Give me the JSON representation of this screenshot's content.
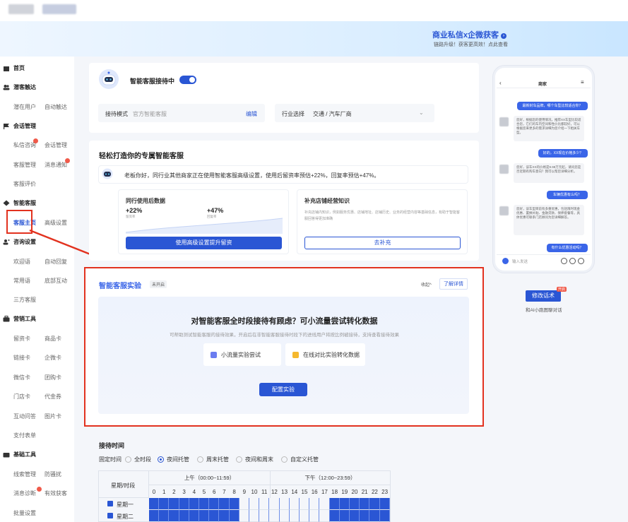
{
  "banner": {
    "title": "商业私信x企微获客",
    "subtitle": "链路升级！获客更高效！点此查看"
  },
  "sidebar": {
    "home": "首页",
    "g_reach": "潜客触达",
    "potential_user": "潜在用户",
    "auto_reach": "自动触达",
    "g_session": "会话管理",
    "private_consult": "私信咨询",
    "session_mgmt": "会话管理",
    "cs_mgmt": "客服管理",
    "msg_notice": "消息通知",
    "cs_review": "客服评价",
    "g_smart": "智能客服",
    "cs_home": "客服主页",
    "advanced": "高级设置",
    "g_consult": "咨询设置",
    "welcome": "欢迎语",
    "auto_reply": "自动回复",
    "common": "常用语",
    "bottom_interact": "底部互动",
    "third_party": "三方客服",
    "g_marketing": "营销工具",
    "reserve_card": "留资卡",
    "goods_card": "商品卡",
    "link_card": "链接卡",
    "wecom_card": "企微卡",
    "wechat_card": "微信卡",
    "group_card": "团购卡",
    "store_card": "门店卡",
    "voucher": "代金券",
    "qa": "互动问答",
    "image_card": "图片卡",
    "pay_form": "支付表单",
    "g_base": "基础工具",
    "clue_mgmt": "线索管理",
    "anti_harass": "防骚扰",
    "msg_diag": "消息诊断",
    "effective_lead": "有效获客",
    "batch_settings": "批量设置"
  },
  "header_card": {
    "bot_title": "智能客服接待中",
    "mode_label": "接待模式",
    "mode_value": "官方智能客服",
    "edit": "编辑",
    "industry_label": "行业选择",
    "industry_value": "交通 / 汽车厂商"
  },
  "promo": {
    "title": "轻松打造你的专属智能客服",
    "message": "老板你好，同行业其他商家正在使用智能客服高级设置，使用后留资率预估+22%，回复率预估+47%。",
    "peer_title": "同行使用后数据",
    "stat1_value": "+22%",
    "stat1_label": "留资率",
    "stat2_value": "+47%",
    "stat2_label": "回复率",
    "peer_btn": "使用高级设置提升留资",
    "kb_title": "补充店铺经营知识",
    "kb_desc": "补充店铺内知识，例如服务优惠、店铺地址、店铺历史、业务的经营内容等基础信息，有助于智能客服回答得更加准确",
    "kb_btn": "去补充"
  },
  "experiment": {
    "title": "智能客服实验",
    "status": "未开启",
    "collapse": "收起^",
    "learn_more": "了解详情",
    "heading": "对智能客服全时段接待有顾虑？可小流量尝试转化数据",
    "desc": "可帮助测试智能客服的接待效果，开启后在非智能客服接待时段下的进线用户将按比例被接待，支持查看接待效果",
    "opt1": "小流量实验尝试",
    "opt2": "在线对比实验转化数据",
    "config_btn": "配置实验"
  },
  "reception": {
    "title": "接待时间",
    "fixed_label": "固定时间",
    "radios": [
      "全时段",
      "夜间托管",
      "周末托管",
      "夜间和周末",
      "自定义托管"
    ],
    "selected_index": 1,
    "col_header": "星期/时段",
    "am": "上午（00:00~11:59）",
    "pm": "下午（12:00~23:59）",
    "hours": [
      "0",
      "1",
      "2",
      "3",
      "4",
      "5",
      "6",
      "7",
      "8",
      "9",
      "10",
      "11",
      "12",
      "13",
      "14",
      "15",
      "16",
      "17",
      "18",
      "19",
      "20",
      "21",
      "22",
      "23"
    ],
    "days": [
      "星期一",
      "星期二"
    ],
    "active_hours": [
      0,
      1,
      2,
      3,
      4,
      5,
      6,
      7,
      8,
      18,
      19,
      20,
      21,
      22,
      23
    ]
  },
  "phone": {
    "title": "商家",
    "q1": "最新封车品牌，哪个车型比较适合你？",
    "a1": "您好，根据您的使用情况，推荐XX车型比较适合您，它们的车内空间和性价比都较好，可以根据您来更多的需求详细为您介绍一下相关车型。",
    "q2": "好的，XX现在价格多少？",
    "a2": "您好，该车XX的价格是9.98万元起，请问您是否近期有购车意向？我可以帮您详细分析。",
    "q3": "车辆优惠有么吗？",
    "a3": "您好，该车型目前有多重优惠，包括限时现金优惠、置换补贴、金融贷款、保养套餐等，具体优惠可联系门店顾问为您详细解答。",
    "q4": "有什么优惠活动吗？",
    "input_placeholder": "输入发送",
    "modify_btn": "修改话术",
    "modify_badge": "开启",
    "caption": "和AI小跑图聊对话"
  },
  "colors": {
    "primary": "#2a56d4",
    "highlight": "#e2321f",
    "badge": "#f05a4a"
  }
}
